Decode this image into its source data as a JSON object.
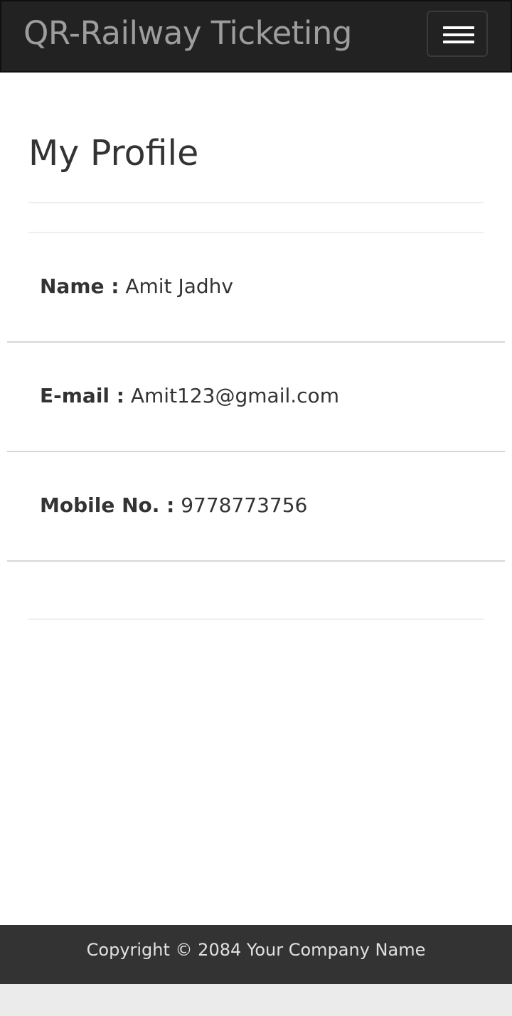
{
  "navbar": {
    "brand": "QR-Railway Ticketing",
    "toggle_icon": "hamburger-menu-icon"
  },
  "page": {
    "title": "My Profile"
  },
  "profile": {
    "name_label": "Name :",
    "name_value": " Amit Jadhv",
    "email_label": "E-mail :",
    "email_value": " Amit123@gmail.com",
    "mobile_label": "Mobile No. :",
    "mobile_value": " 9778773756"
  },
  "footer": {
    "copyright": "Copyright © 2084 Your Company Name"
  },
  "colors": {
    "navbar_bg": "#222222",
    "brand_text": "#9d9d9d",
    "footer_bg": "#333333",
    "page_bg": "#ffffff",
    "text": "#333333"
  }
}
